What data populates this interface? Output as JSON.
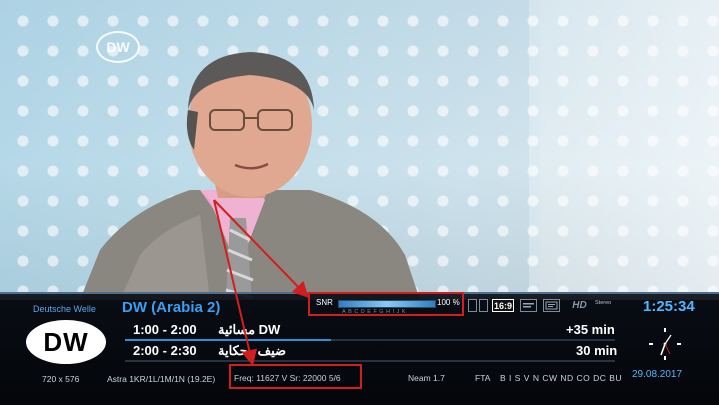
{
  "channel": {
    "provider": "Deutsche Welle",
    "name": "DW (Arabia 2)",
    "logo_text": "DW",
    "bug_text": "DW"
  },
  "clock": {
    "time": "1:25:34",
    "date": "29.08.2017"
  },
  "epg": {
    "current": {
      "time": "1:00 - 2:00",
      "title": "مسائية DW",
      "remaining": "+35 min",
      "progress": 0.42
    },
    "next": {
      "time": "2:00 - 2:30",
      "title": "ضيف وحكاية",
      "duration": "30 min"
    }
  },
  "signal": {
    "snr_label": "SNR",
    "snr_value": "100 %",
    "snr_fraction": 1.0,
    "scale_text": "ABCDEFGHIJK"
  },
  "stream_info": {
    "resolution": "720 x 576",
    "satellite": "Astra 1KR/1L/1M/1N (19.2E)",
    "frequency": "Freq: 11627 V Sr: 22000 5/6",
    "neam": "Neam 1.7",
    "fta": "FTA",
    "ca_flags": "B I S V N CW ND CO DC BU"
  },
  "icons": {
    "ratio": "16:9",
    "hd": "HD",
    "stereo": "Stereo"
  },
  "colors": {
    "accent": "#3a9ff0",
    "annotation": "#d11f1f"
  }
}
